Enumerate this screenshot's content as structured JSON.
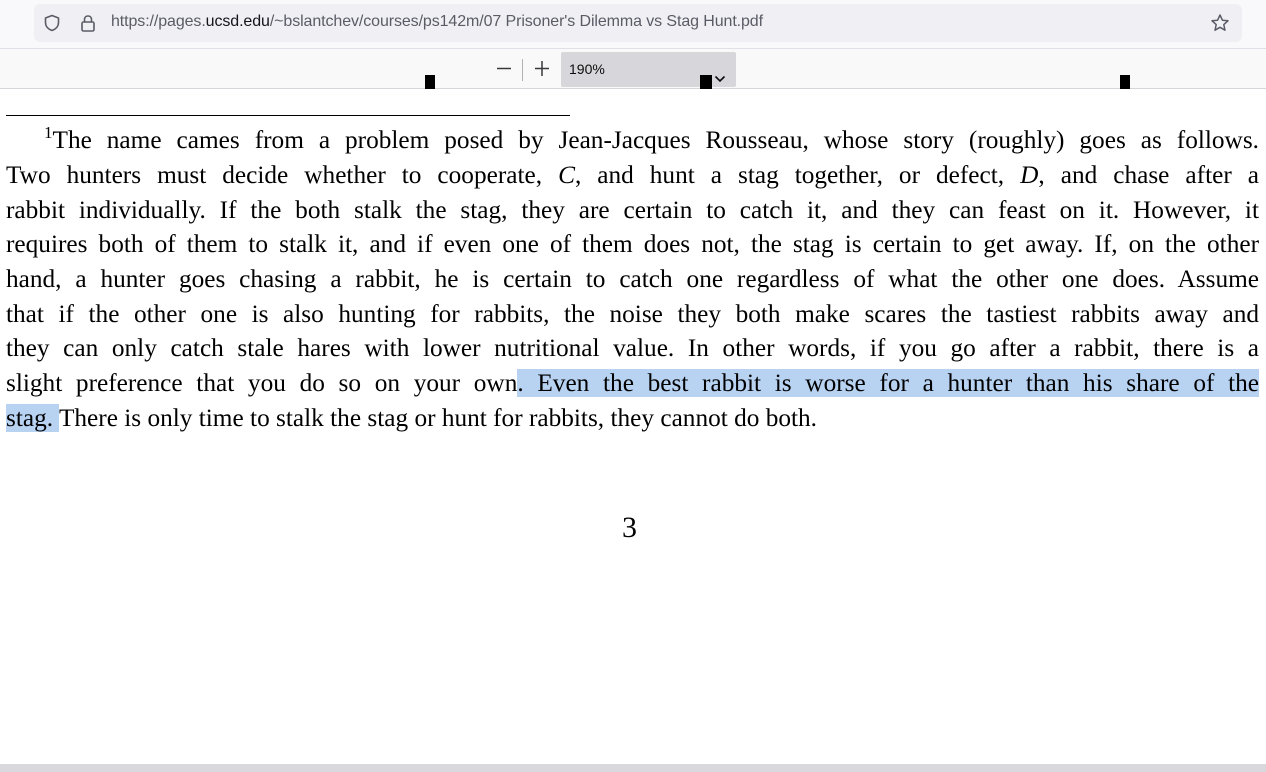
{
  "browser": {
    "url_prefix": "https://pages.",
    "url_domain": "ucsd.edu",
    "url_path": "/~bslantchev/courses/ps142m/07 Prisoner's Dilemma vs Stag Hunt.pdf",
    "icons": [
      "shield-icon",
      "lock-icon",
      "bookmark-star-icon"
    ]
  },
  "pdf_toolbar": {
    "zoom_value": "190%",
    "icons": [
      "zoom-out-icon",
      "zoom-in-icon",
      "chevron-down-icon"
    ]
  },
  "document": {
    "footnote_number": "1",
    "lines": [
      "The name cames from a problem posed by Jean-Jacques Rousseau, whose story (roughly) goes as follows.",
      {
        "a": "Two hunters must decide whether to cooperate, ",
        "m1": "C",
        "b": ", and hunt a stag together, or defect, ",
        "m2": "D",
        "c": ", and chase after a"
      },
      "rabbit individually. If the both stalk the stag, they are certain to catch it, and they can feast on it. However, it",
      "requires both of them to stalk it, and if even one of them does not, the stag is certain to get away. If, on the other",
      "hand, a hunter goes chasing a rabbit, he is certain to catch one regardless of what the other one does. Assume",
      "that if the other one is also hunting for rabbits, the noise they both make scares the tastiest rabbits away and",
      "they can only catch stale hares with lower nutritional value. In other words, if you go after a rabbit, there is a",
      {
        "plain": "slight preference that you do so on your own",
        "selected": ". Even the best rabbit is worse for a hunter than his share of the"
      },
      {
        "selected": "stag. ",
        "plain": "There is only time to stalk the stag or hunt for rabbits, they cannot do both."
      }
    ],
    "page_number": "3"
  }
}
